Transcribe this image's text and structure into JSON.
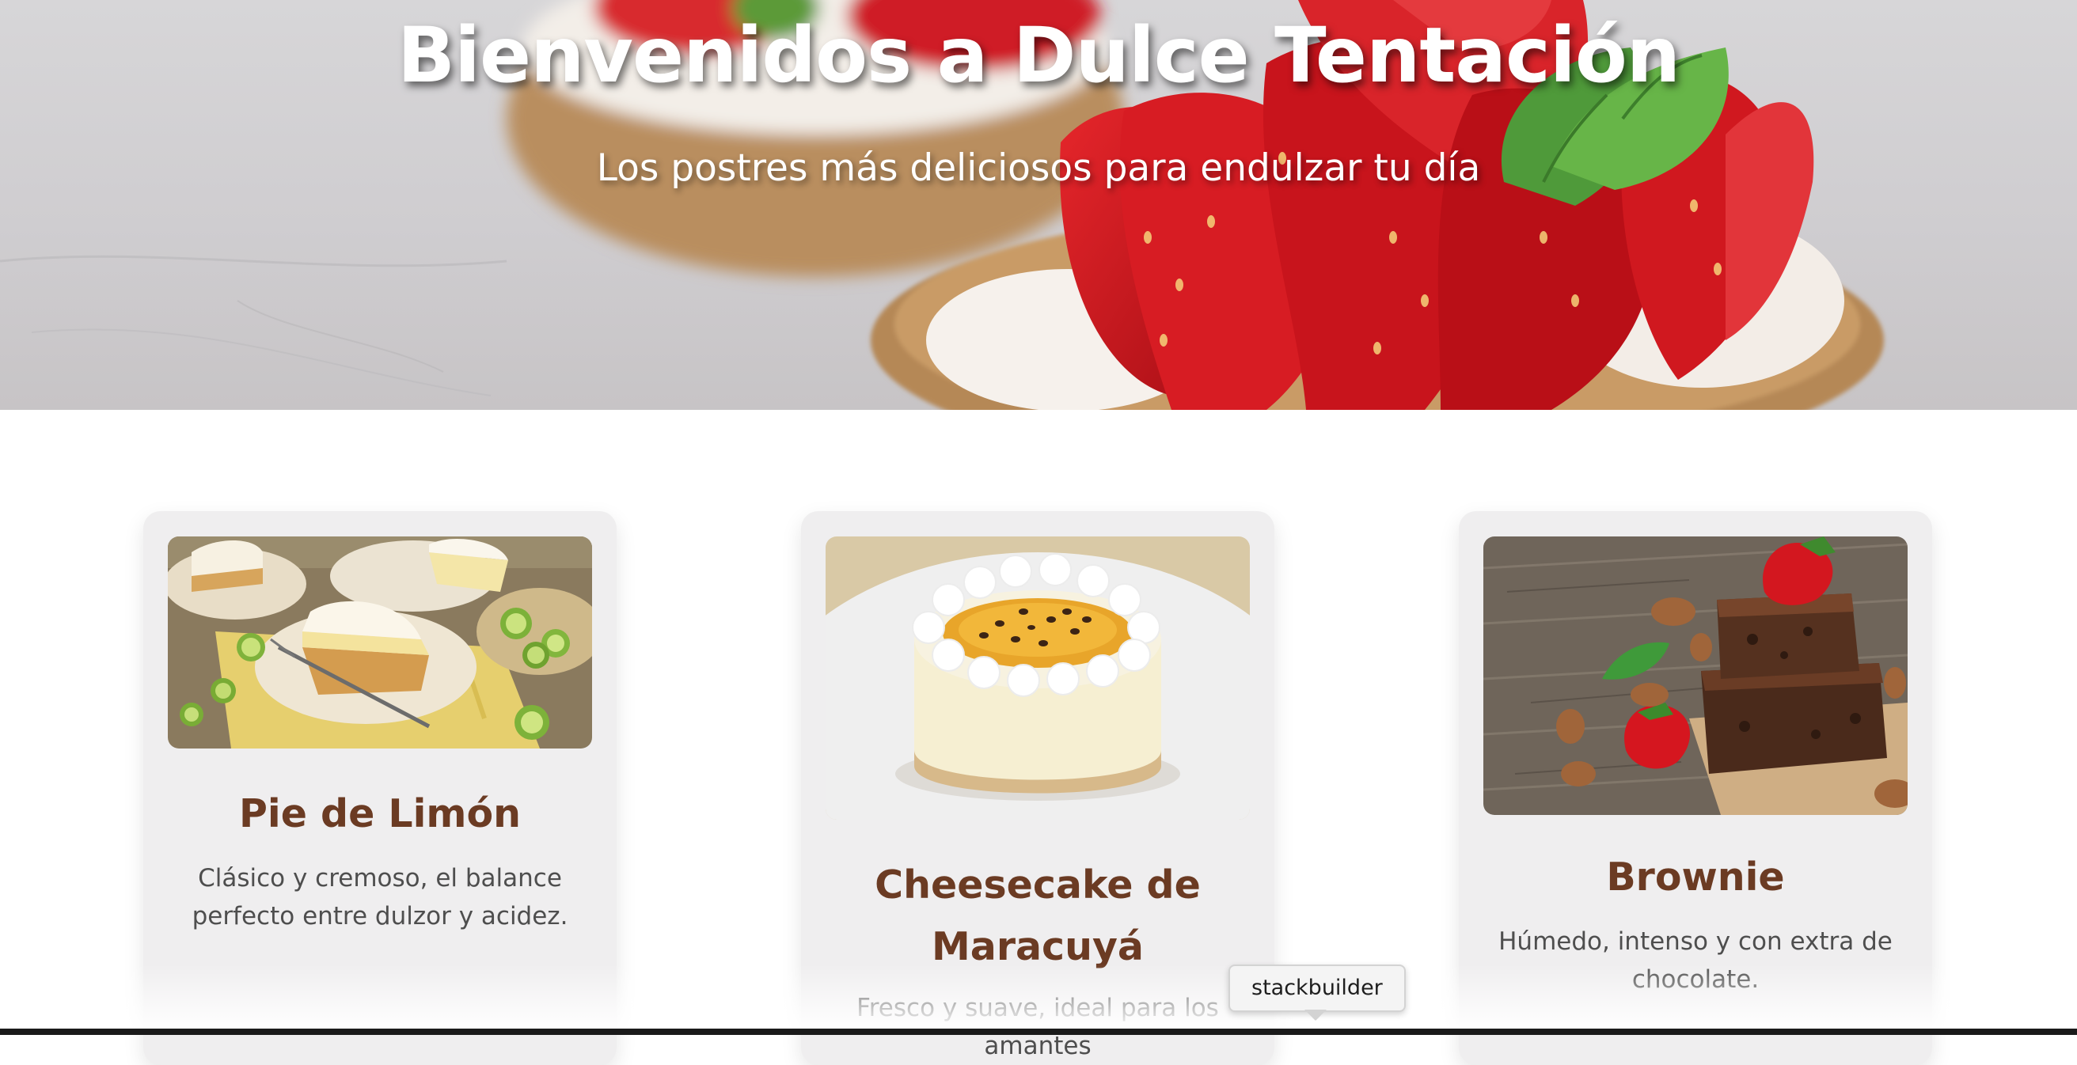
{
  "hero": {
    "title": "Bienvenidos a Dulce Tentación",
    "subtitle": "Los postres más deliciosos para endulzar tu día"
  },
  "cards": [
    {
      "title": "Pie de Limón",
      "description": "Clásico y cremoso, el balance perfecto entre dulzor y acidez.",
      "image_icon": "lemon-pie-photo"
    },
    {
      "title": "Cheesecake de Maracuyá",
      "description": "Fresco y suave, ideal para los amantes",
      "image_icon": "passion-fruit-cheesecake-photo"
    },
    {
      "title": "Brownie",
      "description": "Húmedo, intenso y con extra de chocolate.",
      "image_icon": "brownie-photo"
    }
  ],
  "tooltip": {
    "text": "stackbuilder"
  },
  "colors": {
    "card_title": "#6b3b23",
    "card_background": "#efeeef",
    "hero_text": "#ffffff",
    "strawberry": "#c8141c"
  }
}
